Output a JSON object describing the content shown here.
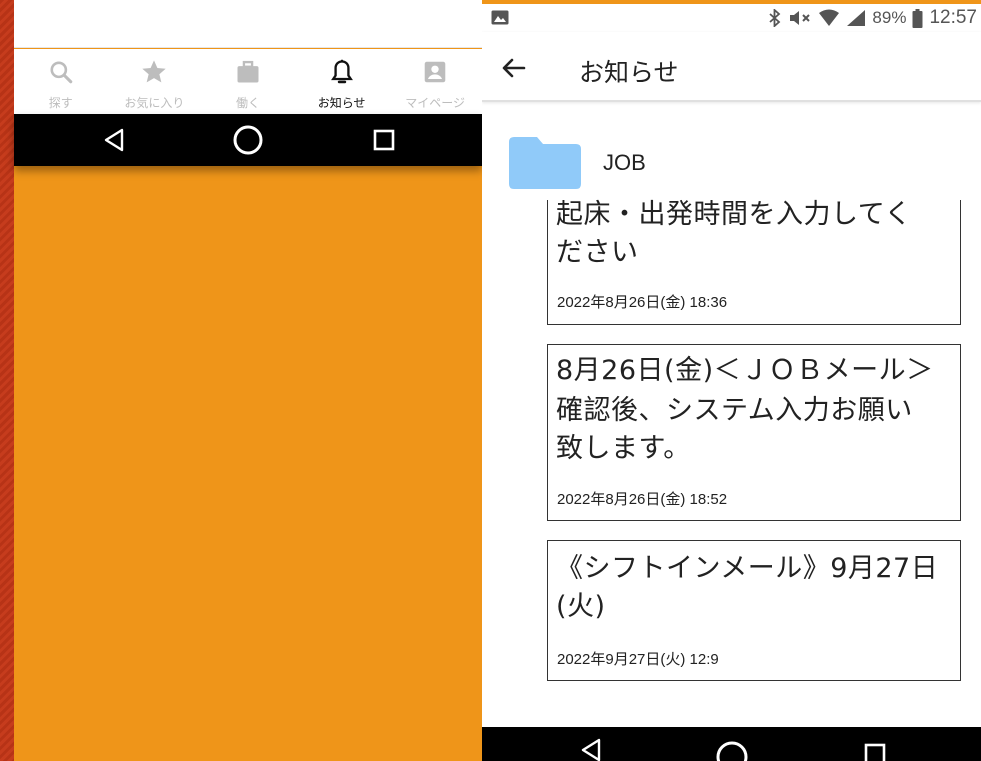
{
  "left_phone": {
    "tabs": [
      {
        "label": "探す",
        "icon": "search-icon"
      },
      {
        "label": "お気に入り",
        "icon": "star-icon"
      },
      {
        "label": "働く",
        "icon": "briefcase-icon"
      },
      {
        "label": "お知らせ",
        "icon": "bell-icon",
        "active": true
      },
      {
        "label": "マイページ",
        "icon": "account-box-icon"
      }
    ]
  },
  "status_bar": {
    "battery_percent": "89%",
    "time": "12:57",
    "icons": [
      "image-icon",
      "bluetooth-icon",
      "mute-icon",
      "wifi-icon",
      "signal-icon",
      "battery-icon"
    ]
  },
  "app_bar": {
    "title": "お知らせ"
  },
  "folder": {
    "label": "JOB",
    "color": "#90caf9"
  },
  "notices": [
    {
      "title_line1": "起床・出発時間を入力してく",
      "title_line2": "ださい",
      "date": "2022年8月26日(金) 18:36"
    },
    {
      "title_line1": "8月26日(金)＜ＪＯＢメール＞",
      "title_line2": "確認後、システム入力お願い",
      "title_line3": "致します。",
      "date": "2022年8月26日(金) 18:52"
    },
    {
      "title_line1": "《シフトインメール》9月27日",
      "title_line2": "(火)",
      "date": "2022年9月27日(火) 12:9"
    }
  ],
  "colors": {
    "background_orange": "#ef9519",
    "accent_red": "#c63c1d",
    "nav_black": "#000000"
  }
}
